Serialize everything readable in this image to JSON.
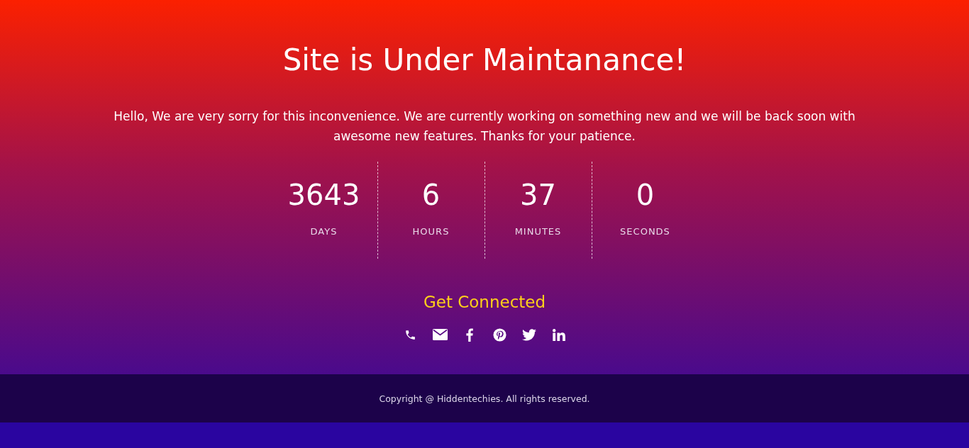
{
  "title": "Site is Under Maintanance!",
  "message": "Hello, We are very sorry for this inconvenience. We are currently working on something new and we will be back soon with awesome new features. Thanks for your patience.",
  "countdown": [
    {
      "value": "3643",
      "label": "DAYS"
    },
    {
      "value": "6",
      "label": "HOURS"
    },
    {
      "value": "37",
      "label": "MINUTES"
    },
    {
      "value": "0",
      "label": "SECONDS"
    }
  ],
  "connect": {
    "heading": "Get Connected",
    "links": [
      {
        "kind": "phone"
      },
      {
        "kind": "mail"
      },
      {
        "kind": "facebook"
      },
      {
        "kind": "pinterest"
      },
      {
        "kind": "twitter"
      },
      {
        "kind": "linkedin"
      }
    ]
  },
  "footer": {
    "copyright": "Copyright @ Hiddentechies. All rights reserved."
  }
}
